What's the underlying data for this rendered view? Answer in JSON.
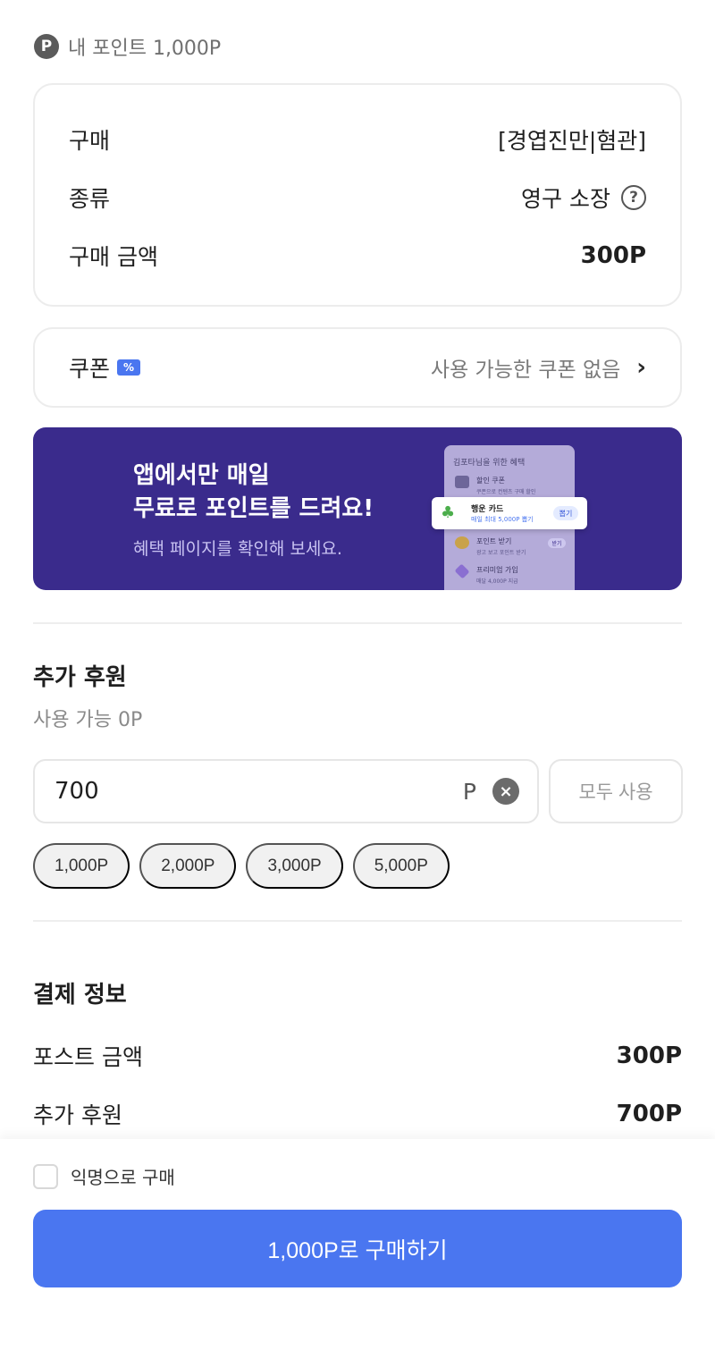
{
  "header": {
    "points_icon": "P",
    "points_text": "내 포인트 1,000P"
  },
  "purchase": {
    "rows": [
      {
        "label": "구매",
        "value": "[경엽진만|혐관]"
      },
      {
        "label": "종류",
        "value": "영구 소장",
        "help_icon": "?"
      },
      {
        "label": "구매 금액",
        "value": "300P"
      }
    ]
  },
  "coupon": {
    "label": "쿠폰",
    "icon": "%",
    "status": "사용 가능한 쿠폰 없음",
    "chevron": "›"
  },
  "banner": {
    "title_line1": "앱에서만 매일",
    "title_line2": "무료로 포인트를 드려요!",
    "subtitle": "혜택 페이지를 확인해 보세요.",
    "bg_color": "#3a2b8c",
    "mockup": {
      "header": "김포타님을 위한 혜택",
      "items": [
        {
          "title": "할인 쿠폰",
          "sub": "쿠폰으로 컨텐츠 구매 할인"
        },
        {
          "title": "포인트 받기",
          "sub": "광고 보고 포인트 받기",
          "button": "받기"
        },
        {
          "title": "프리미엄 가입",
          "sub": "매달 4,000P 지급"
        }
      ],
      "lucky_card": {
        "title": "행운 카드",
        "sub": "매일 최대 5,000P 뽑기",
        "button": "뽑기"
      }
    }
  },
  "donation": {
    "title": "추가 후원",
    "available": "사용 가능 0P",
    "input_value": "700",
    "unit": "P",
    "clear_icon": "×",
    "use_all_label": "모두 사용",
    "chips": [
      "1,000P",
      "2,000P",
      "3,000P",
      "5,000P"
    ]
  },
  "payment": {
    "title": "결제 정보",
    "rows": [
      {
        "label": "포스트 금액",
        "value": "300P"
      },
      {
        "label": "추가 후원",
        "value": "700P"
      }
    ]
  },
  "footer": {
    "anonymous_label": "익명으로 구매",
    "buy_label": "1,000P로 구매하기",
    "accent_color": "#4a76f0"
  }
}
